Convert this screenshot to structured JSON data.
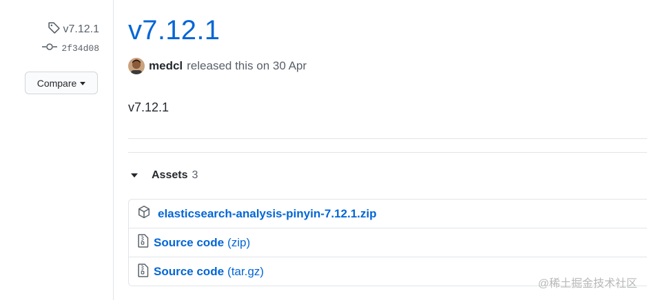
{
  "sidebar": {
    "tag": "v7.12.1",
    "commit": "2f34d08",
    "compare_label": "Compare"
  },
  "release": {
    "title": "v7.12.1",
    "author": "medcl",
    "released_text": "released this on 30 Apr",
    "body": "v7.12.1"
  },
  "assets": {
    "label": "Assets",
    "count": "3",
    "items": [
      {
        "name": "elasticsearch-analysis-pinyin-7.12.1.zip",
        "icon": "package-icon"
      },
      {
        "label": "Source code",
        "ext": "(zip)",
        "icon": "file-zip-icon"
      },
      {
        "label": "Source code",
        "ext": "(tar.gz)",
        "icon": "file-zip-icon"
      }
    ]
  },
  "watermark": "@稀土掘金技术社区",
  "colors": {
    "link": "#0366d6",
    "muted": "#586069",
    "text": "#24292e",
    "border": "#e1e4e8"
  }
}
